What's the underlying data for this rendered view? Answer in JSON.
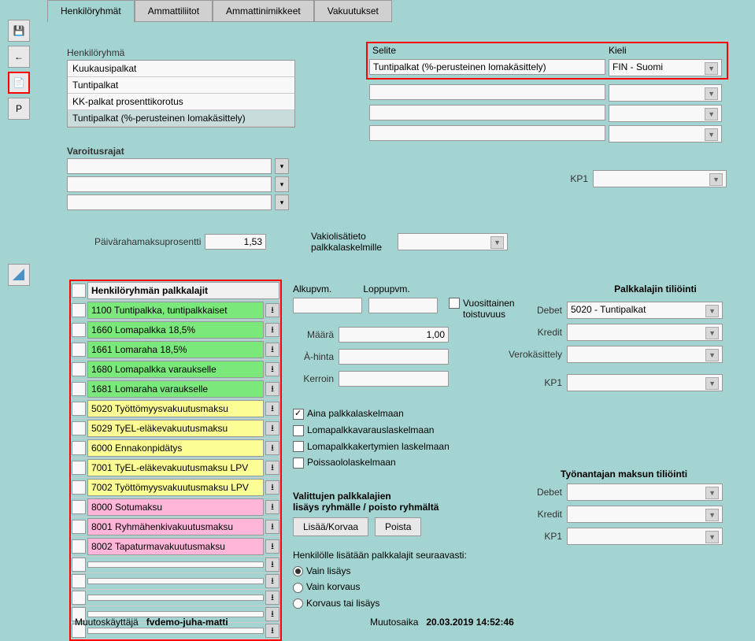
{
  "toolbar": {
    "save": "💾",
    "back": "←",
    "doc": "📄",
    "p": "P"
  },
  "tabs": {
    "t1": "Henkilöryhmät",
    "t2": "Ammattiliitot",
    "t3": "Ammattinimikkeet",
    "t4": "Vakuutukset"
  },
  "henkiloryhma": {
    "label": "Henkilöryhmä",
    "items": [
      "Kuukausipalkat",
      "Tuntipalkat",
      "KK-palkat prosenttikorotus",
      "Tuntipalkat (%-perusteinen lomakäsittely)"
    ]
  },
  "varoitusrajat_label": "Varoitusrajat",
  "paivaraha_label": "Päivärahamaksuprosentti",
  "paivaraha_value": "1,53",
  "vakiolisatieto_label": "Vakiolisätieto palkkalaskelmille",
  "selite": {
    "label": "Selite",
    "value": "Tuntipalkat (%-perusteinen lomakäsittely)"
  },
  "kieli": {
    "label": "Kieli",
    "value": "FIN - Suomi"
  },
  "kp1_label": "KP1",
  "palkkalajit": {
    "header": "Henkilöryhmän palkkalajit",
    "rows": [
      {
        "text": "1100 Tuntipalkka, tuntipalkkaiset",
        "color": "green"
      },
      {
        "text": "1660 Lomapalkka 18,5%",
        "color": "green"
      },
      {
        "text": "1661 Lomaraha 18,5%",
        "color": "green"
      },
      {
        "text": "1680 Lomapalkka varaukselle",
        "color": "green"
      },
      {
        "text": "1681 Lomaraha varaukselle",
        "color": "green"
      },
      {
        "text": "5020 Työttömyysvakuutusmaksu",
        "color": "yellow"
      },
      {
        "text": "5029 TyEL-eläkevakuutusmaksu",
        "color": "yellow"
      },
      {
        "text": "6000 Ennakonpidätys",
        "color": "yellow"
      },
      {
        "text": "7001 TyEL-eläkevakuutusmaksu LPV",
        "color": "yellow"
      },
      {
        "text": "7002 Työttömyysvakuutusmaksu LPV",
        "color": "yellow"
      },
      {
        "text": "8000 Sotumaksu",
        "color": "pink"
      },
      {
        "text": "8001 Ryhmähenkivakuutusmaksu",
        "color": "pink"
      },
      {
        "text": "8002 Tapaturmavakuutusmaksu",
        "color": "pink"
      },
      {
        "text": "",
        "color": "empty"
      },
      {
        "text": "",
        "color": "empty"
      },
      {
        "text": "",
        "color": "empty"
      },
      {
        "text": "",
        "color": "empty"
      },
      {
        "text": "",
        "color": "empty"
      }
    ]
  },
  "dates": {
    "alku_label": "Alkupvm.",
    "loppu_label": "Loppupvm.",
    "vuosittainen": "Vuosittainen toistuvuus"
  },
  "fields": {
    "maara_label": "Määrä",
    "maara_value": "1,00",
    "ahinta_label": "À-hinta",
    "kerroin_label": "Kerroin"
  },
  "checks": {
    "c1": "Aina palkkalaskelmaan",
    "c2": "Lomapalkkavarauslaskelmaan",
    "c3": "Lomapalkkakertymien laskelmaan",
    "c4": "Poissaololaskelmaan"
  },
  "valittujen": {
    "l1": "Valittujen palkkalajien",
    "l2": "lisäys ryhmälle / poisto ryhmältä",
    "btn1": "Lisää/Korvaa",
    "btn2": "Poista"
  },
  "henkilolle": {
    "label": "Henkilölle lisätään palkkalajit seuraavasti:",
    "r1": "Vain lisäys",
    "r2": "Vain korvaus",
    "r3": "Korvaus tai lisäys"
  },
  "tiliointi": {
    "header": "Palkkalajin tiliöinti",
    "debet_label": "Debet",
    "debet_value": "5020 - Tuntipalkat",
    "kredit_label": "Kredit",
    "vero_label": "Verokäsittely",
    "kp1_label": "KP1"
  },
  "tyonantajan": {
    "header": "Työnantajan maksun tiliöinti",
    "debet_label": "Debet",
    "kredit_label": "Kredit",
    "kp1_label": "KP1"
  },
  "footer": {
    "muutoskayttaja_label": "Muutoskäyttäjä",
    "muutoskayttaja_value": "fvdemo-juha-matti",
    "muutosaika_label": "Muutosaika",
    "muutosaika_value": "20.03.2019 14:52:46"
  }
}
